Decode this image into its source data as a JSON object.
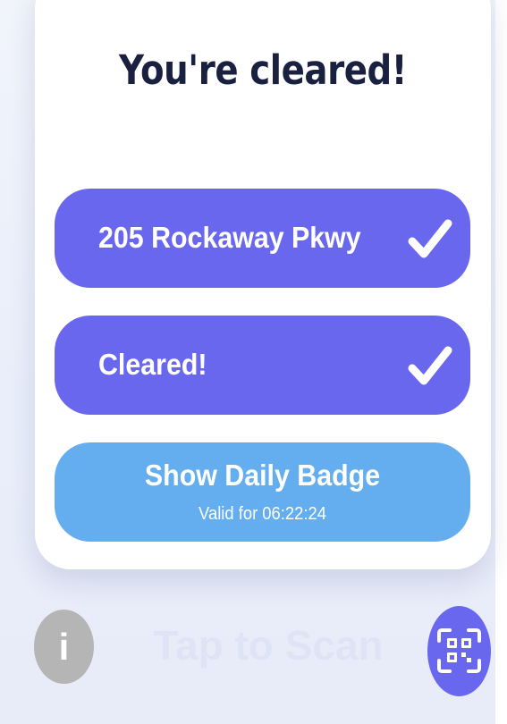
{
  "screen": {
    "title": "You're cleared!"
  },
  "status_rows": [
    {
      "label": "205 Rockaway Pkwy",
      "icon": "checkmark-icon"
    },
    {
      "label": "Cleared!",
      "icon": "checkmark-icon"
    }
  ],
  "badge": {
    "title": "Show Daily Badge",
    "subtitle": "Valid for 06:22:24"
  },
  "footer": {
    "info_glyph": "i",
    "info_icon": "info-icon",
    "scan_icon": "qr-scan-icon",
    "ghost_label": "Tap to Scan"
  },
  "colors": {
    "primary": "#6A67EF",
    "badge": "#64AEEF",
    "title": "#1A2140",
    "info": "#B5B5B5",
    "background": "#EDF1FB"
  }
}
